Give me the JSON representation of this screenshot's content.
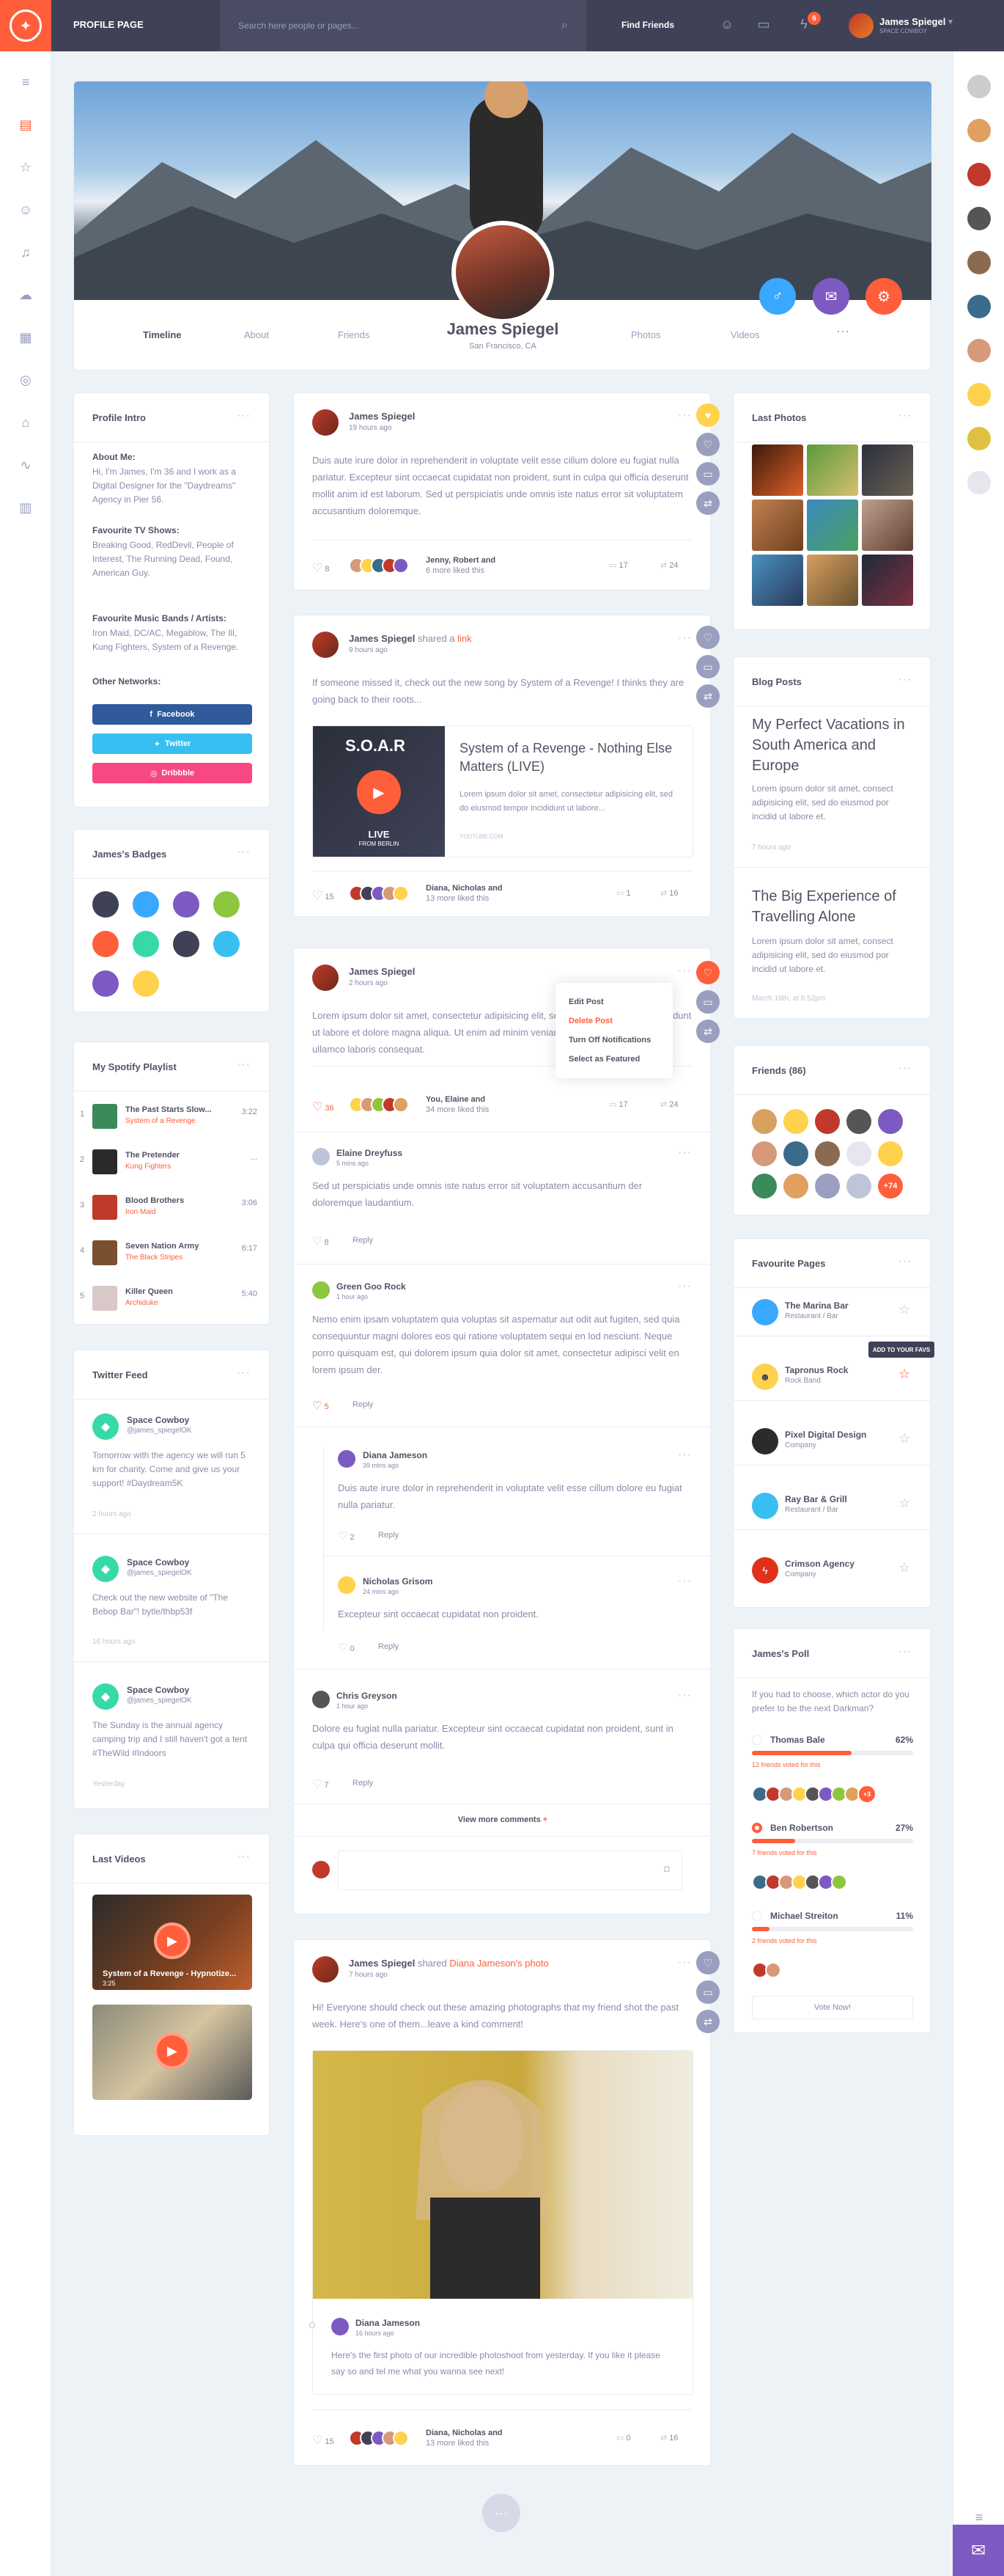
{
  "topbar": {
    "page_label": "PROFILE PAGE",
    "search_placeholder": "Search here people or pages...",
    "find_friends": "Find Friends",
    "badge_count": "6",
    "user_name": "James Spiegel",
    "user_status": "SPACE COWBOY"
  },
  "profile": {
    "name": "James Spiegel",
    "location": "San Francisco, CA",
    "tabs": [
      "Timeline",
      "About",
      "Friends",
      "Photos",
      "Videos"
    ]
  },
  "intro": {
    "title": "Profile Intro",
    "about_label": "About Me:",
    "about": "Hi, I'm James, I'm 36 and I work as a Digital Designer for the \"Daydreams\" Agency in Pier 56.",
    "tv_label": "Favourite TV Shows:",
    "tv": "Breaking Good, RedDevil, People of Interest, The Running Dead, Found, American Guy.",
    "music_label": "Favourite Music Bands / Artists:",
    "music": "Iron Maid, DC/AC, Megablow, The Ill, Kung Fighters, System of a Revenge.",
    "networks_label": "Other Networks:",
    "fb": "Facebook",
    "tw": "Twitter",
    "dr": "Dribbble"
  },
  "badges": {
    "title": "James's Badges"
  },
  "playlist": {
    "title": "My Spotify Playlist",
    "items": [
      {
        "n": "1",
        "t": "The Past Starts Slow...",
        "a": "System of a Revenge",
        "d": "3:22"
      },
      {
        "n": "2",
        "t": "The Pretender",
        "a": "Kung Fighters",
        "d": "..."
      },
      {
        "n": "3",
        "t": "Blood Brothers",
        "a": "Iron Maid",
        "d": "3:06"
      },
      {
        "n": "4",
        "t": "Seven Nation Army",
        "a": "The Black Stripes",
        "d": "6:17"
      },
      {
        "n": "5",
        "t": "Killer Queen",
        "a": "Archiduke",
        "d": "5:40"
      }
    ]
  },
  "twitter": {
    "title": "Twitter Feed",
    "items": [
      {
        "name": "Space Cowboy",
        "handle": "@james_spiegelOK",
        "text": "Tomorrow with the agency we will run 5 km for charity. Come and give us your support! #Daydream5K",
        "time": "2 hours ago"
      },
      {
        "name": "Space Cowboy",
        "handle": "@james_spiegelOK",
        "text": "Check out the new website of \"The Bebop Bar\"! bytle/thbp53f",
        "time": "16 hours ago"
      },
      {
        "name": "Space Cowboy",
        "handle": "@james_spiegelOK",
        "text": "The Sunday is the annual agency camping trip and I still haven't got a tent #TheWild #Indoors",
        "time": "Yesterday"
      }
    ]
  },
  "videos": {
    "title": "Last Videos",
    "v1_title": "System of a Revenge - Hypnotize...",
    "v1_dur": "3:25"
  },
  "posts": [
    {
      "name": "James Spiegel",
      "time": "19 hours ago",
      "text": "Duis aute irure dolor in reprehenderit in voluptate velit esse cillum dolore eu fugiat nulla pariatur. Excepteur sint occaecat cupidatat non proident, sunt in culpa qui officia deserunt mollit anim id est laborum. Sed ut perspiciatis unde omnis iste natus error sit voluptatem accusantium doloremque.",
      "likes": "8",
      "likers": "Jenny, Robert and",
      "likers2": "6 more liked this",
      "comments": "17",
      "shares": "24"
    },
    {
      "name": "James Spiegel",
      "shared": "shared a",
      "link": "link",
      "time": "9 hours ago",
      "text": "If someone missed it, check out the new song by System of a Revenge! I thinks they are going back to their roots...",
      "lnk_title": "System of a Revenge - Nothing Else Matters (LIVE)",
      "lnk_text": "Lorem ipsum dolor sit amet, consectetur adipisicing elit, sed do eiusmod tempor incididunt ut labore...",
      "lnk_src": "YOUTUBE.COM",
      "lnk_thumb_title": "S.O.A.R",
      "lnk_thumb_sub": "LIVE",
      "lnk_thumb_sub2": "FROM BERLIN",
      "likes": "15",
      "likers": "Diana, Nicholas and",
      "likers2": "13 more liked this",
      "comments": "1",
      "shares": "16"
    },
    {
      "name": "James Spiegel",
      "time": "2 hours ago",
      "text": "Lorem ipsum dolor sit amet, consectetur adipisicing elit, sed do eiusmod tempor incididunt ut labore et dolore magna aliqua. Ut enim ad minim veniam, quis nostrud exercitation ullamco laboris consequat.",
      "likes": "36",
      "likers": "You, Elaine and",
      "likers2": "34 more liked this",
      "comments": "17",
      "shares": "24"
    },
    {
      "name": "James Spiegel",
      "shared": "shared",
      "link": "Diana Jameson's photo",
      "time": "7 hours ago",
      "text": "Hi! Everyone should check out these amazing photographs that my friend shot the past week. Here's one of them...leave a kind comment!",
      "inner_name": "Diana Jameson",
      "inner_time": "16 hours ago",
      "inner_text": "Here's the first photo of our incredible photoshoot from yesterday. If you like it please say so and tel me what you wanna see next!",
      "likes": "15",
      "likers": "Diana, Nicholas and",
      "likers2": "13 more liked this",
      "comments": "0",
      "shares": "16"
    }
  ],
  "menu": [
    "Edit Post",
    "Delete Post",
    "Turn Off Notifications",
    "Select as Featured"
  ],
  "comments": [
    {
      "name": "Elaine Dreyfuss",
      "time": "5 mins ago",
      "text": "Sed ut perspiciatis unde omnis iste natus error sit voluptatem accusantium der doloremque laudantium.",
      "likes": "8",
      "reply": "Reply"
    },
    {
      "name": "Green Goo Rock",
      "time": "1 hour ago",
      "text": "Nemo enim ipsam voluptatem quia voluptas sit aspernatur aut odit aut fugiten, sed quia consequuntur magni dolores eos qui ratione voluptatem sequi en lod nesciunt. Neque porro quisquam est, qui dolorem ipsum quia dolor sit amet, consectetur adipisci velit en lorem ipsum der.",
      "likes": "5",
      "reply": "Reply"
    },
    {
      "name": "Diana Jameson",
      "time": "39 mins ago",
      "text": "Duis aute irure dolor in reprehenderit in voluptate velit esse cillum dolore eu fugiat nulla pariatur.",
      "likes": "2",
      "reply": "Reply"
    },
    {
      "name": "Nicholas Grisom",
      "time": "24 mins ago",
      "text": "Excepteur sint occaecat cupidatat non proident.",
      "likes": "0",
      "reply": "Reply"
    },
    {
      "name": "Chris Greyson",
      "time": "1 hour ago",
      "text": "Dolore eu fugiat nulla pariatur. Excepteur sint occaecat cupidatat non proident, sunt in culpa qui officia deserunt mollit.",
      "likes": "7",
      "reply": "Reply"
    }
  ],
  "view_more": "View more comments",
  "photos": {
    "title": "Last Photos"
  },
  "blog": {
    "title": "Blog Posts",
    "items": [
      {
        "t": "My Perfect Vacations in South America and Europe",
        "x": "Lorem ipsum dolor sit amet, consect adipisicing elit, sed do eiusmod por incidid ut labore et.",
        "time": "7 hours ago"
      },
      {
        "t": "The Big Experience of Travelling Alone",
        "x": "Lorem ipsum dolor sit amet, consect adipisicing elit, sed do eiusmod por incidid ut labore et.",
        "time": "March 18th, at 6:52pm"
      }
    ]
  },
  "friends": {
    "title": "Friends (86)",
    "more": "+74"
  },
  "pages": {
    "title": "Favourite Pages",
    "tooltip": "ADD TO YOUR FAVS",
    "items": [
      {
        "n": "The Marina Bar",
        "s": "Restaurant / Bar"
      },
      {
        "n": "Tapronus Rock",
        "s": "Rock Band"
      },
      {
        "n": "Pixel Digital Design",
        "s": "Company"
      },
      {
        "n": "Ray Bar & Grill",
        "s": "Restaurant / Bar"
      },
      {
        "n": "Crimson Agency",
        "s": "Company"
      }
    ]
  },
  "poll": {
    "title": "James's Poll",
    "question": "If you had to choose, which actor do you prefer to be the next Darkman?",
    "opts": [
      {
        "n": "Thomas Bale",
        "p": "62%",
        "v": "12 friends voted for this",
        "f": 0.62
      },
      {
        "n": "Ben Robertson",
        "p": "27%",
        "v": "7 friends voted for this",
        "f": 0.27
      },
      {
        "n": "Michael Streiton",
        "p": "11%",
        "v": "2 friends voted for this",
        "f": 0.11
      }
    ],
    "vote": "Vote Now!",
    "more": "+3"
  }
}
